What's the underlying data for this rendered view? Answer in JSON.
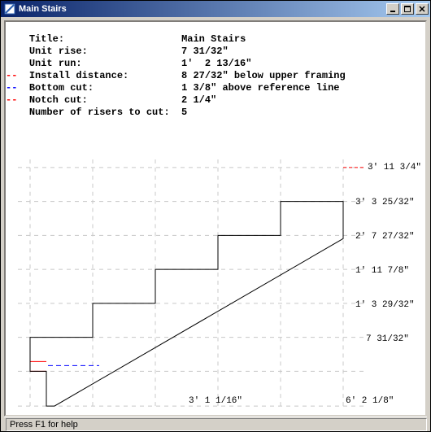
{
  "window": {
    "title": "Main Stairs"
  },
  "info": {
    "title_label": "Title:",
    "title_value": "Main Stairs",
    "unit_rise_label": "Unit rise:",
    "unit_rise_value": "7 31/32\"",
    "unit_run_label": "Unit run:",
    "unit_run_value": "1'  2 13/16\"",
    "install_dist_label": "Install distance:",
    "install_dist_value": "8 27/32\" below upper framing",
    "bottom_cut_label": "Bottom cut:",
    "bottom_cut_value": "1 3/8\" above reference line",
    "notch_cut_label": "Notch cut:",
    "notch_cut_value": "2 1/4\"",
    "risers_label": "Number of risers to cut:",
    "risers_value": "5",
    "tick_install": "--",
    "tick_bottom": "--",
    "tick_notch": "--",
    "pad": "  "
  },
  "dims": {
    "r0": "3' 11 3/4\"",
    "r1": "3'  3 25/32\"",
    "r2": "2'  7 27/32\"",
    "r3": "1' 11 7/8\"",
    "r4": "1'  3 29/32\"",
    "r5": "7 31/32\"",
    "b1": "3'  1 1/16\"",
    "b2": "6'  2 1/8\""
  },
  "status": {
    "help": "Press F1 for help"
  }
}
